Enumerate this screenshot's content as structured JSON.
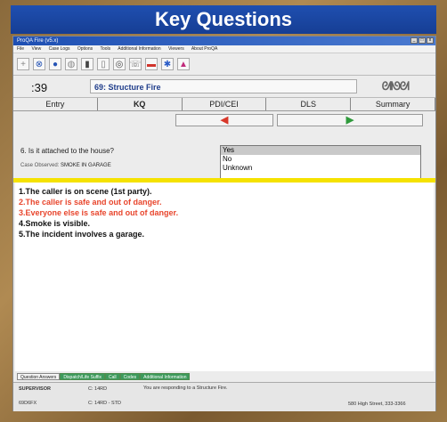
{
  "banner": {
    "title": "Key Questions"
  },
  "window": {
    "title": "ProQA Fire (v5.x)",
    "menu": [
      "File",
      "View",
      "Case Logs",
      "Options",
      "Tools",
      "Additional Information",
      "Viewers",
      "About ProQA"
    ]
  },
  "case": {
    "call_number": ":39",
    "chief_complaint": "69: Structure Fire"
  },
  "tabs": [
    {
      "label": "Entry"
    },
    {
      "label": "KQ"
    },
    {
      "label": "PDI/CEI"
    },
    {
      "label": "DLS"
    },
    {
      "label": "Summary"
    }
  ],
  "question": {
    "text": "6.  Is it attached to the house?",
    "case_observed_label": "Case Observed:",
    "case_observed_value": "SMOKE IN GARAGE"
  },
  "answers": {
    "options": [
      "Yes",
      "No",
      "Unknown"
    ],
    "selected": "Yes"
  },
  "responses": [
    {
      "text": "1.The caller is on scene (1st party).",
      "color": "black"
    },
    {
      "text": "2.The caller is safe and out of danger.",
      "color": "red"
    },
    {
      "text": "3.Everyone else is safe and out of danger.",
      "color": "red"
    },
    {
      "text": "4.Smoke is visible.",
      "color": "black"
    },
    {
      "text": "5.The incident involves a garage.",
      "color": "black"
    }
  ],
  "bottom_tabs": [
    "Question Answers",
    "Dispatch/Life Suffix",
    "Call",
    "Codes",
    "Additional Information"
  ],
  "status": {
    "supervisor": "SUPERVISOR",
    "code": "69D6FX",
    "m1": "C: 14RD",
    "m2": "C: 14RD - STD",
    "responding": "You are responding to a Structure Fire.",
    "address": "580 High Street, 333-3366"
  },
  "colors": {
    "banner": "#1f4fb0",
    "red": "#e8452c",
    "highlight": "#f5e200"
  }
}
